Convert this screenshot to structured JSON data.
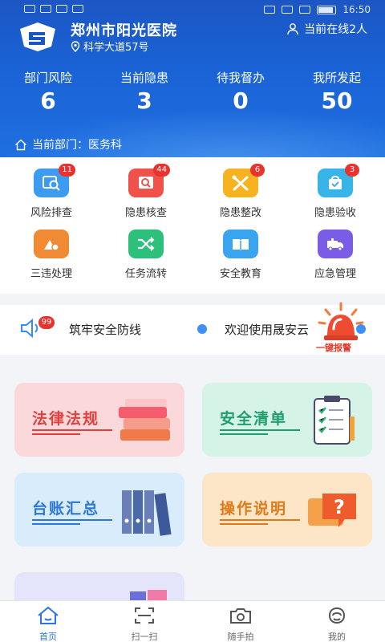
{
  "status_bar": {
    "time": "16:50"
  },
  "header": {
    "hospital_name": "郑州市阳光医院",
    "address": "科学大道57号",
    "online": "当前在线2人",
    "department": "当前部门：医务科"
  },
  "stats": [
    {
      "label": "部门风险",
      "value": "6"
    },
    {
      "label": "当前隐患",
      "value": "3"
    },
    {
      "label": "待我督办",
      "value": "0"
    },
    {
      "label": "我所发起",
      "value": "50"
    }
  ],
  "grid": [
    {
      "label": "风险排查",
      "badge": "11",
      "icon": "risk-search-icon",
      "color": "#3d9bf2"
    },
    {
      "label": "隐患核查",
      "badge": "44",
      "icon": "hazard-check-icon",
      "color": "#f0524a"
    },
    {
      "label": "隐患整改",
      "badge": "6",
      "icon": "rectify-tools-icon",
      "color": "#f6b21f"
    },
    {
      "label": "隐患验收",
      "badge": "3",
      "icon": "acceptance-bag-icon",
      "color": "#38b4e8"
    },
    {
      "label": "三违处理",
      "badge": "",
      "icon": "violation-icon",
      "color": "#f08a34"
    },
    {
      "label": "任务流转",
      "badge": "",
      "icon": "task-flow-icon",
      "color": "#2cc07a"
    },
    {
      "label": "安全教育",
      "badge": "",
      "icon": "education-book-icon",
      "color": "#3aa4ee"
    },
    {
      "label": "应急管理",
      "badge": "",
      "icon": "emergency-truck-icon",
      "color": "#7a5ce6"
    }
  ],
  "notice": {
    "badge": "99",
    "text1": "筑牢安全防线",
    "text2": "欢迎使用晟安云"
  },
  "alarm": {
    "label": "一键报警"
  },
  "cards": [
    {
      "title": "法律法规",
      "icon": "law-books-icon",
      "bg": "#fbd9db",
      "fg": "#e2403e"
    },
    {
      "title": "安全清单",
      "icon": "checklist-clipboard-icon",
      "bg": "#d5f4e7",
      "fg": "#1f9d6b"
    },
    {
      "title": "台账汇总",
      "icon": "ledger-binders-icon",
      "bg": "#d8ecfb",
      "fg": "#2c78d4"
    },
    {
      "title": "操作说明",
      "icon": "help-question-icon",
      "bg": "#fde6c7",
      "fg": "#e07a18"
    },
    {
      "title": "",
      "icon": "folders-icon",
      "bg": "#e4e5fb",
      "fg": "#6b6fd8"
    }
  ],
  "tabs": [
    {
      "label": "首页",
      "icon": "home-icon",
      "active": true
    },
    {
      "label": "扫一扫",
      "icon": "scan-icon",
      "active": false
    },
    {
      "label": "随手拍",
      "icon": "camera-icon",
      "active": false
    },
    {
      "label": "我的",
      "icon": "profile-icon",
      "active": false
    }
  ]
}
